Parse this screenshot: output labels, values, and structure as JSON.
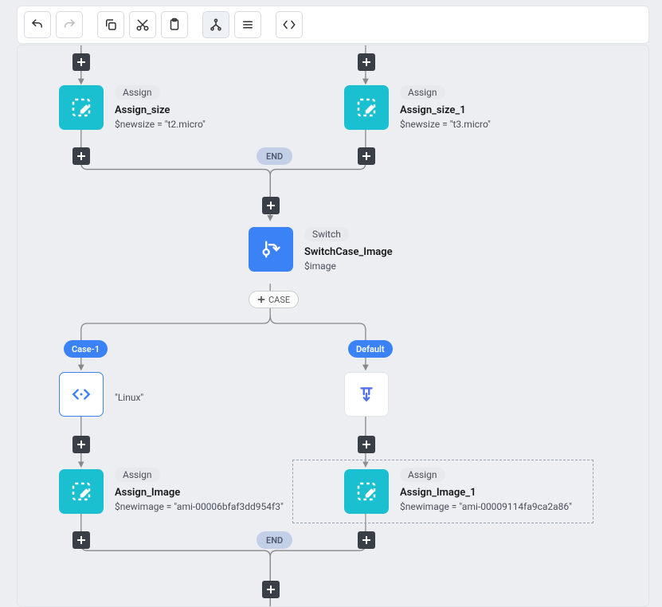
{
  "toolbar": {
    "items": [
      "undo",
      "redo",
      "copy",
      "cut",
      "paste",
      "tree",
      "list",
      "code"
    ]
  },
  "nodes": {
    "assign_size": {
      "chip": "Assign",
      "title": "Assign_size",
      "sub": "$newsize = \"t2.micro\""
    },
    "assign_size1": {
      "chip": "Assign",
      "title": "Assign_size_1",
      "sub": "$newsize = \"t3.micro\""
    },
    "switch_img": {
      "chip": "Switch",
      "title": "SwitchCase_Image",
      "sub": "$image"
    },
    "assign_img": {
      "chip": "Assign",
      "title": "Assign_Image",
      "sub": "$newimage = \"ami-00006bfaf3dd954f3\""
    },
    "assign_img1": {
      "chip": "Assign",
      "title": "Assign_Image_1",
      "sub": "$newimage = \"ami-00009114fa9ca2a86\""
    }
  },
  "labels": {
    "end": "END",
    "case1": "Case-1",
    "default": "Default",
    "addcase": "CASE",
    "linux": "\"Linux\""
  }
}
